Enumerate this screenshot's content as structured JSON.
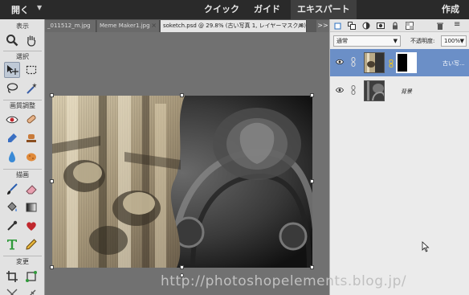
{
  "topbar": {
    "open_label": "開く",
    "modes": [
      "クイック",
      "ガイド",
      "エキスパート"
    ],
    "active_mode": "エキスパート",
    "create_label": "作成"
  },
  "tabs": [
    {
      "label": "_011512_m.jpg"
    },
    {
      "label": "Meme Maker1.jpg"
    },
    {
      "label": "soketch.psd @ 29.8% (古い写真 1, レイヤーマスク/8)",
      "active": true
    }
  ],
  "tab_more": ">>",
  "tools": {
    "sections": {
      "view": "表示",
      "select": "選択",
      "enhance": "画質調整",
      "draw": "描画",
      "modify": "変更"
    }
  },
  "layers_panel": {
    "blend_mode": "通常",
    "opacity_label": "不透明度:",
    "opacity_value": "100%",
    "layers": [
      {
        "name": "古い写...",
        "selected": true
      },
      {
        "name": "背景",
        "selected": false
      }
    ]
  },
  "watermark": "http://photoshopelements.blog.jp/",
  "colors": {
    "topbar_bg": "#2a2a2a",
    "canvas_bg": "#717171",
    "selected_layer": "#6b8fc7",
    "panel_bg": "#ebebeb"
  }
}
